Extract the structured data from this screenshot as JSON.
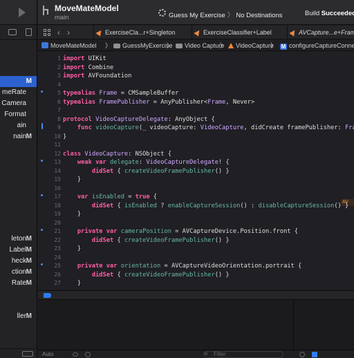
{
  "toolbar": {
    "project_name": "MoveMateModel",
    "branch": "main",
    "scheme_name": "Guess My Exercise",
    "destination": "No Destinations",
    "status_prefix": "Build ",
    "status_result": "Succeeded"
  },
  "navigator": {
    "items": [
      {
        "name": "",
        "status": "M",
        "selected": true
      },
      {
        "name": "meRate",
        "status": "",
        "selected": false
      },
      {
        "name": "Camera",
        "status": "",
        "selected": false
      },
      {
        "name": "Format",
        "status": "",
        "selected": false
      },
      {
        "name": "ain",
        "status": "",
        "selected": false
      },
      {
        "name": "nain",
        "status": "M",
        "selected": false
      },
      {
        "name": "leton",
        "status": "M",
        "selected": false
      },
      {
        "name": "Label",
        "status": "M",
        "selected": false
      },
      {
        "name": "heck",
        "status": "M",
        "selected": false
      },
      {
        "name": "ction",
        "status": "M",
        "selected": false
      },
      {
        "name": "Rate",
        "status": "M",
        "selected": false
      },
      {
        "name": "ller",
        "status": "M",
        "selected": false
      }
    ]
  },
  "tabs": [
    {
      "label": "ExerciseCla...r+Singleton",
      "italic": false
    },
    {
      "label": "ExerciseClassifier+Label",
      "italic": false
    },
    {
      "label": "AVCapture...e+Fram",
      "italic": true
    }
  ],
  "jumpbar": [
    "MoveMateModel",
    "GuessMyExercise",
    "Video Capture",
    "VideoCapture",
    "configureCaptureConne"
  ],
  "code_lines": [
    {
      "n": "1",
      "html": "<span class='kw'>import</span> UIKit"
    },
    {
      "n": "2",
      "html": "<span class='kw'>import</span> Combine"
    },
    {
      "n": "3",
      "html": "<span class='kw'>import</span> AVFoundation"
    },
    {
      "n": "4",
      "html": ""
    },
    {
      "n": "5",
      "html": "<span class='kw'>typealias</span> <span class='ty'>Frame</span> = CMSampleBuffer"
    },
    {
      "n": "6",
      "html": "<span class='kw'>typealias</span> <span class='ty'>FramePublisher</span> = AnyPublisher&lt;<span class='ty'>Frame</span>, Never&gt;"
    },
    {
      "n": "7",
      "html": ""
    },
    {
      "n": "8",
      "html": "<span class='kw'>protocol</span> <span class='ty'>VideoCaptureDelegate</span>: AnyObject {"
    },
    {
      "n": "9",
      "html": "    <span class='kw'>func</span> <span class='fn'>videoCapture</span>(_ videoCapture: <span class='ty'>VideoCapture</span>, didCreate framePublisher: <span class='ty'>FramePublisher</span>)"
    },
    {
      "n": "10",
      "html": "}"
    },
    {
      "n": "11",
      "html": ""
    },
    {
      "n": "12",
      "html": "<span class='kw'>class</span> <span class='ty'>VideoCapture</span>: NSObject {"
    },
    {
      "n": "13",
      "html": "    <span class='kw'>weak</span> <span class='kw'>var</span> <span class='fn'>delegate</span>: <span class='ty'>VideoCaptureDelegate</span>! {"
    },
    {
      "n": "14",
      "html": "        <span class='kw'>didSet</span> { <span class='fn'>createVideoFramePublisher</span>() }"
    },
    {
      "n": "15",
      "html": "    }"
    },
    {
      "n": "16",
      "html": ""
    },
    {
      "n": "17",
      "html": "    <span class='kw'>var</span> <span class='fn'>isEnabled</span> = <span class='kw'>true</span> {"
    },
    {
      "n": "18",
      "html": "        <span class='kw'>didSet</span> { <span class='fn'>isEnabled</span> ? <span class='fn'>enableCaptureSession</span>() : <span class='fn'>disableCaptureSession</span>() }"
    },
    {
      "n": "19",
      "html": "    }"
    },
    {
      "n": "20",
      "html": ""
    },
    {
      "n": "21",
      "html": "    <span class='kw'>private</span> <span class='kw'>var</span> <span class='fn'>cameraPosition</span> = AVCaptureDevice.Position.front {"
    },
    {
      "n": "22",
      "html": "        <span class='kw'>didSet</span> { <span class='fn'>createVideoFramePublisher</span>() }"
    },
    {
      "n": "23",
      "html": "    }"
    },
    {
      "n": "24",
      "html": ""
    },
    {
      "n": "25",
      "html": "    <span class='kw'>private</span> <span class='kw'>var</span> <span class='fn'>orientation</span> = AVCaptureVideoOrientation.portrait {"
    },
    {
      "n": "26",
      "html": "        <span class='kw'>didSet</span> { <span class='fn'>createVideoFramePublisher</span>() }"
    },
    {
      "n": "27",
      "html": "    }"
    }
  ],
  "warning_badge": "AV",
  "debug": {
    "scope": "Auto",
    "filter_placeholder": "Filter"
  },
  "colors": {
    "keyword": "#fc5fa3",
    "type": "#d0a8ff",
    "function": "#67b7a4",
    "selection": "#2c61cf",
    "accent": "#2f7bf0"
  }
}
